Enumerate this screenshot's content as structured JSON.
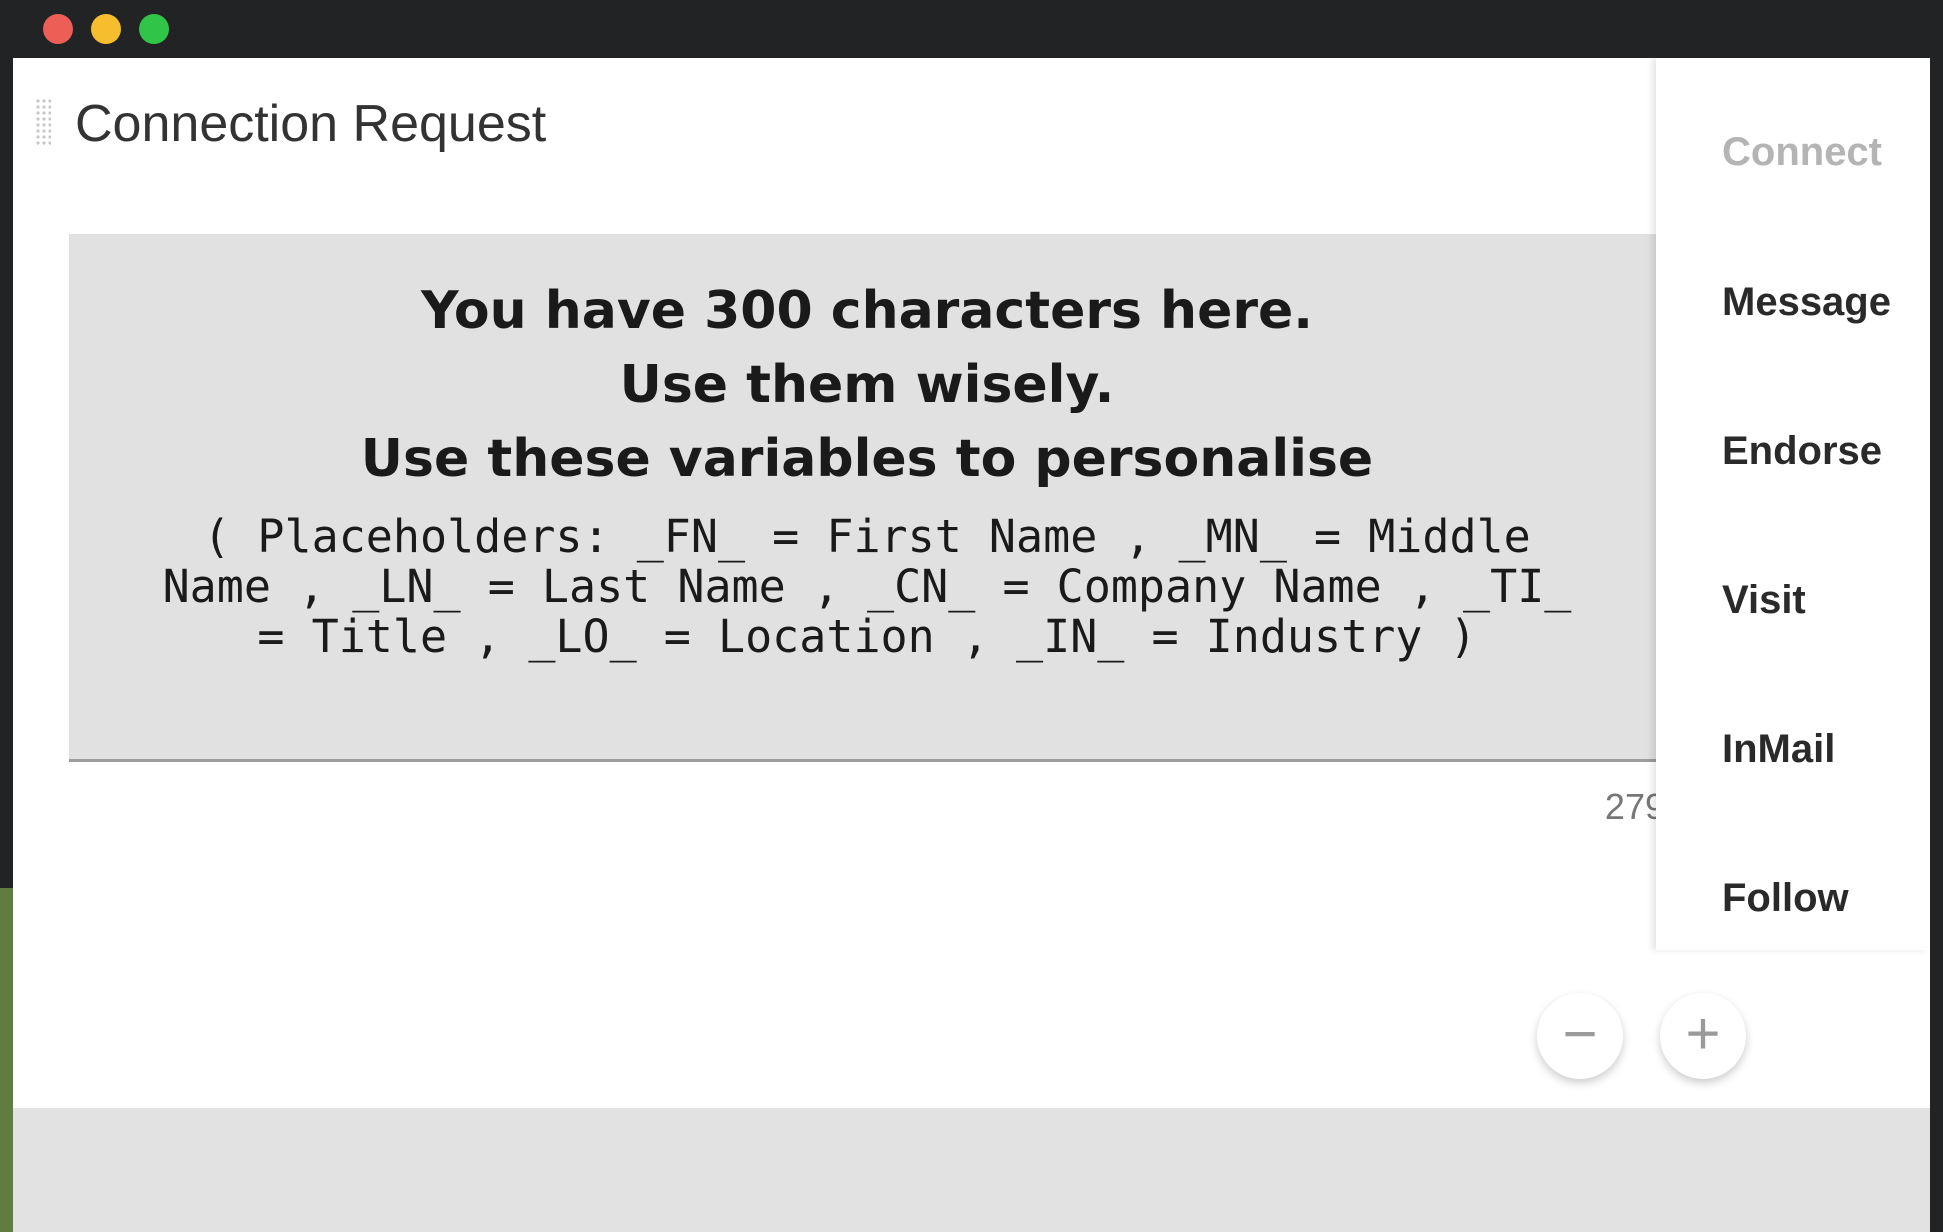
{
  "window_controls": {
    "close_color": "#ed5e56",
    "minimize_color": "#f6bd2e",
    "maximize_color": "#30c448"
  },
  "panel": {
    "title": "Connection Request"
  },
  "editor": {
    "line1": "You have 300 characters here.",
    "line2": "Use them wisely.",
    "line3": "Use these variables to personalise",
    "placeholders": "( Placeholders: _FN_ = First Name , _MN_ = Middle Name , _LN_ = Last Name , _CN_ = Company Name , _TI_ = Title , _LO_ = Location , _IN_ = Industry )"
  },
  "char_count": "279",
  "sidebar": {
    "items": [
      {
        "label": "Connect",
        "state": "disabled"
      },
      {
        "label": "Message",
        "state": "enabled"
      },
      {
        "label": "Endorse",
        "state": "enabled"
      },
      {
        "label": "Visit",
        "state": "enabled"
      },
      {
        "label": "InMail",
        "state": "enabled"
      },
      {
        "label": "Follow",
        "state": "enabled"
      }
    ]
  },
  "zoom": {
    "minus_symbol": "−",
    "plus_symbol": "+"
  }
}
